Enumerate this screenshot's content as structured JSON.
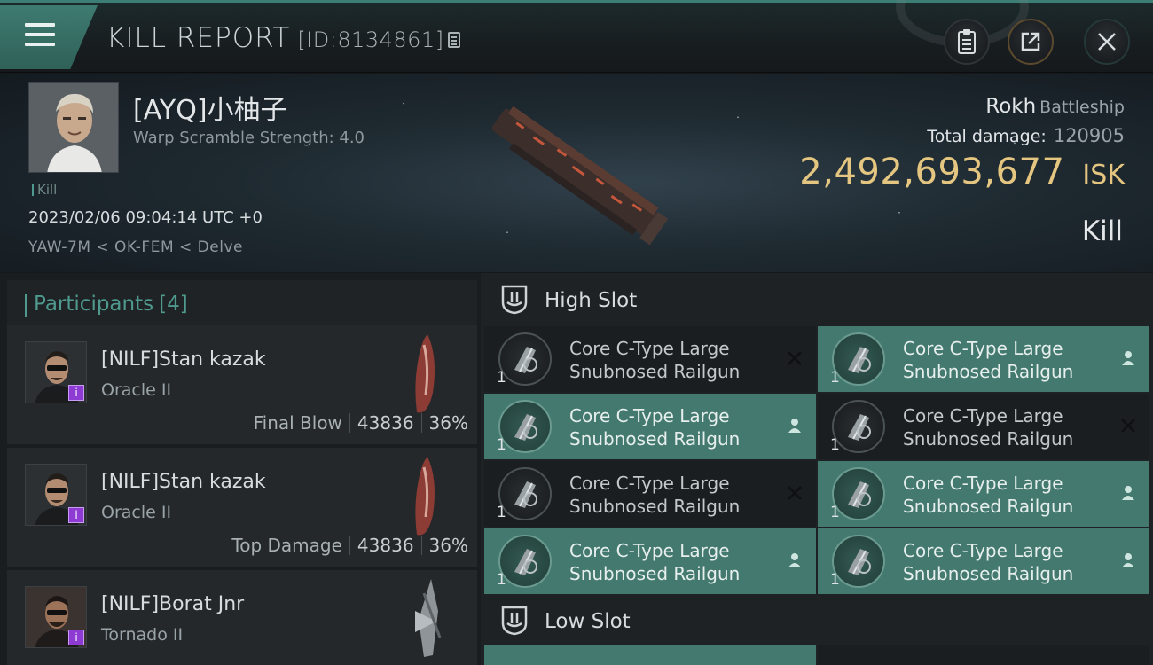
{
  "header": {
    "title": "KILL REPORT",
    "report_id": "[ID:8134861]"
  },
  "victim": {
    "name": "[AYQ]小柚子",
    "warp_scramble": "Warp Scramble Strength: 4.0",
    "tag": "Kill",
    "datetime": "2023/02/06 09:04:14 UTC +0",
    "location": "YAW-7M < OK-FEM < Delve",
    "ship_name": "Rokh",
    "ship_class": "Battleship",
    "total_damage_label": "Total damage:",
    "total_damage": "120905",
    "isk_value": "2,492,693,677",
    "isk_unit": "ISK",
    "result": "Kill"
  },
  "participants": {
    "label": "Participants",
    "count": "[4]",
    "items": [
      {
        "name": "[NILF]Stan kazak",
        "ship": "Oracle II",
        "role": "Final Blow",
        "damage": "43836",
        "percent": "36%"
      },
      {
        "name": "[NILF]Stan kazak",
        "ship": "Oracle II",
        "role": "Top Damage",
        "damage": "43836",
        "percent": "36%"
      },
      {
        "name": "[NILF]Borat Jnr",
        "ship": "Tornado II",
        "role": "",
        "damage": "",
        "percent": ""
      }
    ]
  },
  "fitting": {
    "high_slot_label": "High Slot",
    "low_slot_label": "Low Slot",
    "high_slots": [
      {
        "name": "Core C-Type Large Snubnosed Railgun",
        "qty": "1",
        "state": "destroyed"
      },
      {
        "name": "Core C-Type Large Snubnosed Railgun",
        "qty": "1",
        "state": "dropped"
      },
      {
        "name": "Core C-Type Large Snubnosed Railgun",
        "qty": "1",
        "state": "dropped"
      },
      {
        "name": "Core C-Type Large Snubnosed Railgun",
        "qty": "1",
        "state": "destroyed"
      },
      {
        "name": "Core C-Type Large Snubnosed Railgun",
        "qty": "1",
        "state": "destroyed"
      },
      {
        "name": "Core C-Type Large Snubnosed Railgun",
        "qty": "1",
        "state": "dropped"
      },
      {
        "name": "Core C-Type Large Snubnosed Railgun",
        "qty": "1",
        "state": "dropped"
      },
      {
        "name": "Core C-Type Large Snubnosed Railgun",
        "qty": "1",
        "state": "dropped"
      }
    ]
  },
  "icons": {
    "menu": "hamburger-icon",
    "copy": "copy-icon",
    "clipboard": "clipboard-icon",
    "share": "share-icon",
    "close": "close-icon",
    "slot": "slot-shield-icon",
    "dropped": "person-icon",
    "destroyed": "x-icon"
  },
  "colors": {
    "accent_teal": "#44796f",
    "isk_gold": "#e4c681",
    "badge_purple": "#8d3bd3"
  }
}
